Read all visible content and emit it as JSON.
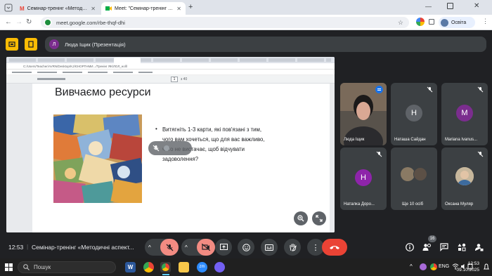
{
  "tabs": [
    {
      "label": "Семінар-тренінг «Методичні а",
      "active": false
    },
    {
      "label": "Meet: \"Семінар-тренінг «М",
      "active": true
    }
  ],
  "url": "meet.google.com/rbe-thqf-dhi",
  "profile_label": "Освіта",
  "presenter_avatar_letter": "Л",
  "presenter_label": "Люда Іщик (Презентація)",
  "shared": {
    "path": "C:/Users/Teacher/AVRN/Desktop/KJ/ЄНОРТНМИ.../Тренінг ЯК/ЛОЛ_ноlll",
    "page": "1",
    "page_total": "з 40",
    "slide_title": "Вивчаємо ресурси",
    "bullet": "Витягніть 1-3 карти, які пов'язані з тим, чого вам хочеться, що для вас важливо, чого не вистачає, щоб відчувати задоволення?"
  },
  "participants": [
    {
      "name": "Люда Іщик"
    },
    {
      "name": "Наташа Сайдан",
      "letter": "Н",
      "color": "#5f6368"
    },
    {
      "name": "Mariana Ivanus...",
      "letter": "M",
      "color": "#7b2d8e"
    },
    {
      "name": "Наталка Доро...",
      "letter": "Н",
      "color": "#8e24aa"
    },
    {
      "name": "Ще 10 осіб"
    },
    {
      "name": "Оксана Муляр"
    }
  ],
  "bottom": {
    "time": "12:53",
    "meeting_title": "Семінар-тренінг «Методичні аспект...",
    "people_count": "16"
  },
  "taskbar": {
    "search_placeholder": "Пошук",
    "lang": "ENG",
    "clock_time": "12:53",
    "clock_date": "09.10.2025"
  },
  "colors": {
    "end_call": "#ea4335",
    "mute_red": "#f28b82",
    "tile_bg": "#3c4043"
  }
}
